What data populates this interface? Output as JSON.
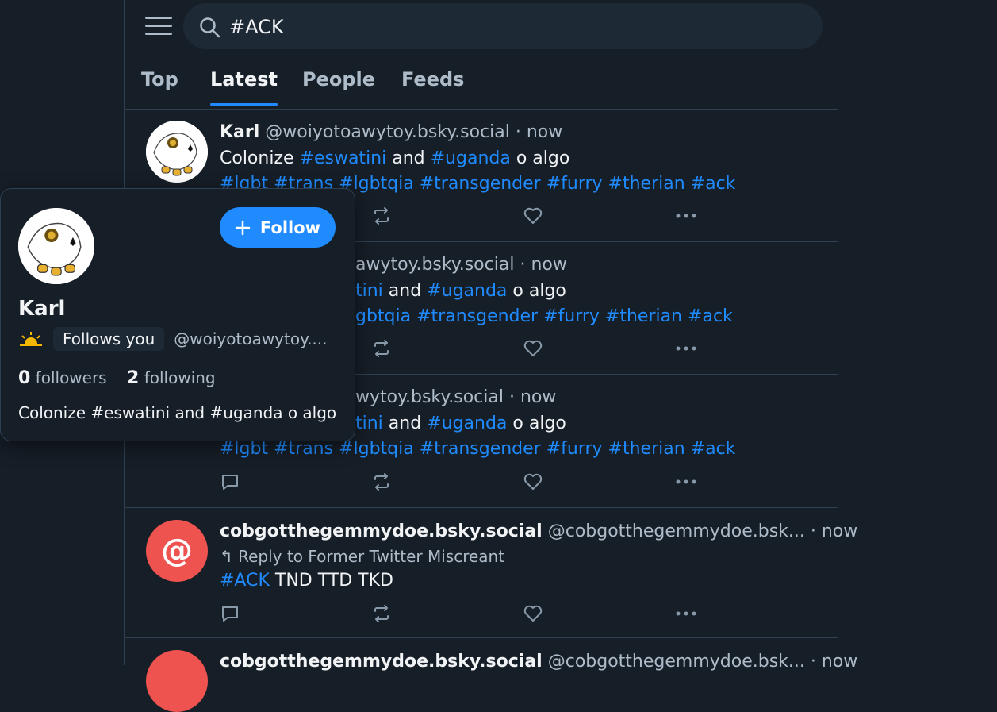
{
  "search": {
    "value": "#ACK"
  },
  "tabs": [
    {
      "label": "Top"
    },
    {
      "label": "Latest"
    },
    {
      "label": "People"
    },
    {
      "label": "Feeds"
    }
  ],
  "posts": [
    {
      "name": "Karl",
      "handle": "@woiyotoawytoy.bsky.social",
      "time": "· now",
      "line1_a": "Colonize ",
      "line1_tag1": "#eswatini",
      "line1_b": " and ",
      "line1_tag2": "#uganda",
      "line1_c": " o algo",
      "tags": "#lgbt #trans #lgbtqia #transgender #furry #therian #ack"
    },
    {
      "handle_partial": "awytoy.bsky.social",
      "time": "· now",
      "tag1_partial": "tini",
      "line1_b": " and ",
      "line1_tag2": "#uganda",
      "line1_c": " o algo",
      "tags_partial": "gbtqia #transgender #furry #therian #ack"
    },
    {
      "handle_partial": "wytoy.bsky.social",
      "time": "· now",
      "tag1_partial": "tini",
      "line1_b": " and ",
      "line1_tag2": "#uganda",
      "line1_c": " o algo",
      "tags": "#lgbt #trans #lgbtqia #transgender #furry #therian #ack"
    },
    {
      "name": "cobgotthegemmydoe.bsky.social",
      "handle": "@cobgotthegemmydoe.bsk...",
      "time": "· now",
      "reply": "Reply to Former Twitter Miscreant",
      "tag": "#ACK",
      "text": " TND TTD TKD"
    },
    {
      "name": "cobgotthegemmydoe.bsky.social",
      "handle": "@cobgotthegemmydoe.bsk...",
      "time": "· now"
    }
  ],
  "popup": {
    "follow_label": "Follow",
    "name": "Karl",
    "follows_you": "Follows you",
    "handle": "@woiyotoawytoy....",
    "followers_count": "0",
    "followers_label": "followers",
    "following_count": "2",
    "following_label": "following",
    "bio": "Colonize #eswatini and #uganda o algo"
  },
  "colors": {
    "accent": "#208bfe",
    "background": "#161e27",
    "avatar_at": "#ef5350"
  }
}
